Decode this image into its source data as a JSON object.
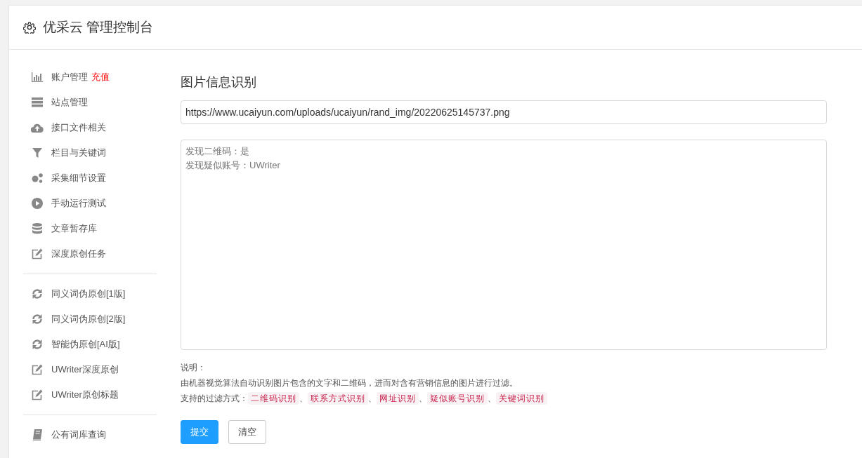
{
  "header": {
    "title": "优采云 管理控制台"
  },
  "sidebar": {
    "groups": [
      [
        {
          "label": "账户管理",
          "badge": "充值"
        },
        {
          "label": "站点管理"
        },
        {
          "label": "接口文件相关"
        },
        {
          "label": "栏目与关键词"
        },
        {
          "label": "采集细节设置"
        },
        {
          "label": "手动运行测试"
        },
        {
          "label": "文章暂存库"
        },
        {
          "label": "深度原创任务"
        }
      ],
      [
        {
          "label": "同义词伪原创[1版]"
        },
        {
          "label": "同义词伪原创[2版]"
        },
        {
          "label": "智能伪原创[AI版]"
        },
        {
          "label": "UWriter深度原创"
        },
        {
          "label": "UWriter原创标题"
        }
      ],
      [
        {
          "label": "公有词库查询"
        }
      ]
    ]
  },
  "main": {
    "title": "图片信息识别",
    "url_field": {
      "value": "https://www.ucaiyun.com/uploads/ucaiyun/rand_img/20220625145737.png"
    },
    "result_field": {
      "lines": [
        "发现二维码：是",
        "发现疑似账号：UWriter"
      ]
    },
    "notes": {
      "heading": "说明：",
      "description": "由机器视觉算法自动识别图片包含的文字和二维码，进而对含有营销信息的图片进行过滤。",
      "filters_label": "支持的过滤方式：",
      "filters": [
        {
          "kind": "tag",
          "text": "二维码识别"
        },
        {
          "kind": "sep",
          "text": "、"
        },
        {
          "kind": "tag",
          "text": "联系方式识别"
        },
        {
          "kind": "sep",
          "text": "、"
        },
        {
          "kind": "tag",
          "text": "网址识别"
        },
        {
          "kind": "sep",
          "text": "、"
        },
        {
          "kind": "tag",
          "text": "疑似账号识别"
        },
        {
          "kind": "sep",
          "text": "、"
        },
        {
          "kind": "tag",
          "text": "关键词识别"
        }
      ]
    },
    "buttons": [
      {
        "label": "提交",
        "kind": "primary"
      },
      {
        "label": "清空",
        "kind": "default"
      }
    ]
  }
}
